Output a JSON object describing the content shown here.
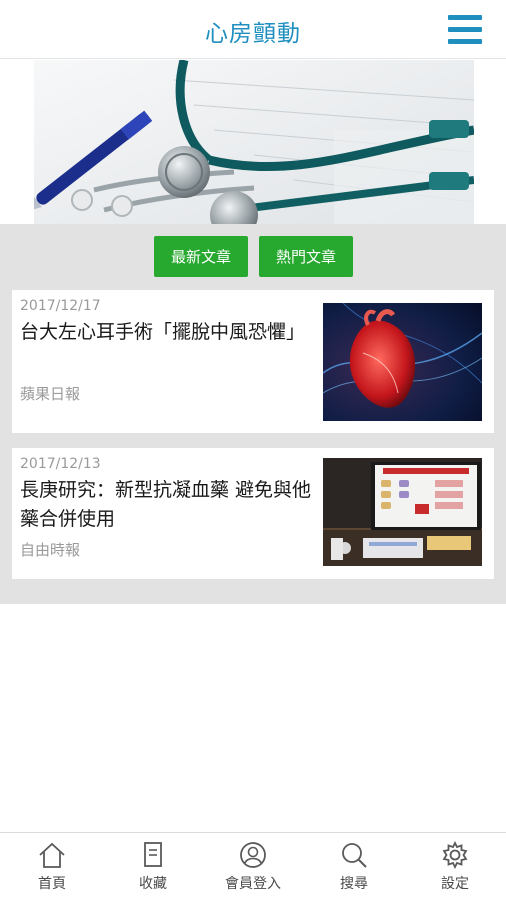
{
  "header": {
    "title": "心房顫動"
  },
  "tabs": {
    "latest": "最新文章",
    "hot": "熱門文章"
  },
  "articles": [
    {
      "date": "2017/12/17",
      "headline": "台大左心耳手術「擺脫中風恐懼」",
      "source": "蘋果日報"
    },
    {
      "date": "2017/12/13",
      "headline": "長庚研究：新型抗凝血藥 避免與他藥合併使用",
      "source": "自由時報"
    }
  ],
  "nav": [
    {
      "label": "首頁",
      "icon": "home-icon"
    },
    {
      "label": "收藏",
      "icon": "bookmark-icon"
    },
    {
      "label": "會員登入",
      "icon": "user-icon"
    },
    {
      "label": "搜尋",
      "icon": "search-icon"
    },
    {
      "label": "設定",
      "icon": "gear-icon"
    }
  ],
  "colors": {
    "accent": "#1f8fc0",
    "tab_green": "#27a82f",
    "background_gray": "#e2e2e2"
  }
}
